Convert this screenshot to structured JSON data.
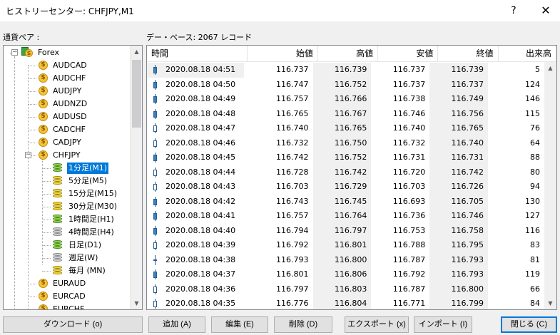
{
  "window": {
    "title": "ヒストリーセンター: CHFJPY,M1",
    "help": "?",
    "close": "✕"
  },
  "left_label": "通貨ペア :",
  "right_label": "デー・ベース: 2067 レコード",
  "tree": {
    "root": "Forex",
    "pairs_before": [
      "AUDCAD",
      "AUDCHF",
      "AUDJPY",
      "AUDNZD",
      "AUDUSD",
      "CADCHF",
      "CADJPY",
      "CHFJPY"
    ],
    "timeframes": [
      {
        "label": "1分足(M1)",
        "icon": "green",
        "selected": true
      },
      {
        "label": "5分足(M5)",
        "icon": "yellow",
        "selected": false
      },
      {
        "label": "15分足(M15)",
        "icon": "yellow",
        "selected": false
      },
      {
        "label": "30分足(M30)",
        "icon": "yellow",
        "selected": false
      },
      {
        "label": "1時間足(H1)",
        "icon": "green",
        "selected": false
      },
      {
        "label": "4時間足(H4)",
        "icon": "gray",
        "selected": false
      },
      {
        "label": "日足(D1)",
        "icon": "green",
        "selected": false
      },
      {
        "label": "週足(W)",
        "icon": "gray",
        "selected": false
      },
      {
        "label": "毎月 (MN)",
        "icon": "yellow",
        "selected": false
      }
    ],
    "pairs_after": [
      "EURAUD",
      "EURCAD",
      "EURCHF"
    ]
  },
  "table": {
    "columns": [
      "時間",
      "始値",
      "高値",
      "安値",
      "終値",
      "出来高"
    ],
    "rows": [
      {
        "time": "2020.08.18 04:51",
        "open": "116.737",
        "high": "116.739",
        "low": "116.737",
        "close": "116.739",
        "volume": "5",
        "candle": "bull"
      },
      {
        "time": "2020.08.18 04:50",
        "open": "116.747",
        "high": "116.752",
        "low": "116.737",
        "close": "116.737",
        "volume": "124",
        "candle": "bull"
      },
      {
        "time": "2020.08.18 04:49",
        "open": "116.757",
        "high": "116.766",
        "low": "116.738",
        "close": "116.749",
        "volume": "146",
        "candle": "bull"
      },
      {
        "time": "2020.08.18 04:48",
        "open": "116.765",
        "high": "116.767",
        "low": "116.746",
        "close": "116.756",
        "volume": "115",
        "candle": "bull"
      },
      {
        "time": "2020.08.18 04:47",
        "open": "116.740",
        "high": "116.765",
        "low": "116.740",
        "close": "116.765",
        "volume": "76",
        "candle": "bear"
      },
      {
        "time": "2020.08.18 04:46",
        "open": "116.732",
        "high": "116.750",
        "low": "116.732",
        "close": "116.740",
        "volume": "64",
        "candle": "bear"
      },
      {
        "time": "2020.08.18 04:45",
        "open": "116.742",
        "high": "116.752",
        "low": "116.731",
        "close": "116.731",
        "volume": "88",
        "candle": "bull"
      },
      {
        "time": "2020.08.18 04:44",
        "open": "116.728",
        "high": "116.742",
        "low": "116.720",
        "close": "116.742",
        "volume": "80",
        "candle": "bear"
      },
      {
        "time": "2020.08.18 04:43",
        "open": "116.703",
        "high": "116.729",
        "low": "116.703",
        "close": "116.726",
        "volume": "94",
        "candle": "bear"
      },
      {
        "time": "2020.08.18 04:42",
        "open": "116.743",
        "high": "116.745",
        "low": "116.693",
        "close": "116.705",
        "volume": "130",
        "candle": "bull"
      },
      {
        "time": "2020.08.18 04:41",
        "open": "116.757",
        "high": "116.764",
        "low": "116.736",
        "close": "116.746",
        "volume": "127",
        "candle": "bull"
      },
      {
        "time": "2020.08.18 04:40",
        "open": "116.794",
        "high": "116.797",
        "low": "116.753",
        "close": "116.758",
        "volume": "116",
        "candle": "bull"
      },
      {
        "time": "2020.08.18 04:39",
        "open": "116.792",
        "high": "116.801",
        "low": "116.788",
        "close": "116.795",
        "volume": "83",
        "candle": "bear"
      },
      {
        "time": "2020.08.18 04:38",
        "open": "116.793",
        "high": "116.800",
        "low": "116.787",
        "close": "116.793",
        "volume": "81",
        "candle": "doji"
      },
      {
        "time": "2020.08.18 04:37",
        "open": "116.801",
        "high": "116.806",
        "low": "116.792",
        "close": "116.793",
        "volume": "119",
        "candle": "bull"
      },
      {
        "time": "2020.08.18 04:36",
        "open": "116.797",
        "high": "116.803",
        "low": "116.787",
        "close": "116.800",
        "volume": "66",
        "candle": "bear"
      },
      {
        "time": "2020.08.18 04:35",
        "open": "116.776",
        "high": "116.804",
        "low": "116.771",
        "close": "116.799",
        "volume": "84",
        "candle": "bear"
      }
    ]
  },
  "buttons": {
    "download": "ダウンロード (o)",
    "add": "追加 (A)",
    "edit": "編集 (E)",
    "delete": "削除 (D)",
    "export": "エクスポート (x)",
    "import": "インポート (I)",
    "close": "閉じる (C)"
  }
}
